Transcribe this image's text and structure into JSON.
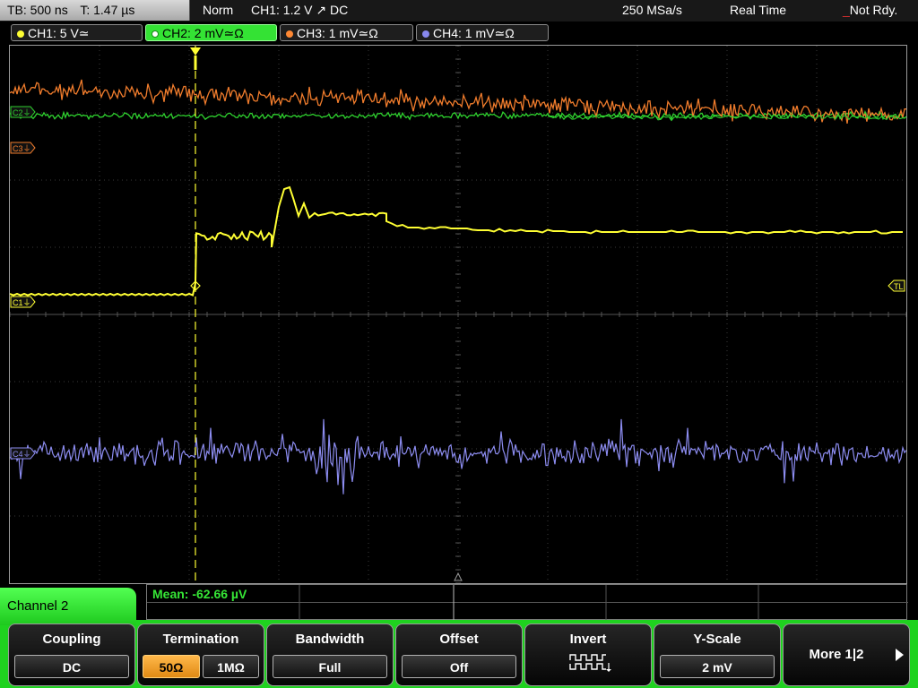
{
  "status": {
    "timebase": "TB: 500 ns",
    "trigger_time": "T: 1.47 µs",
    "mode": "Norm",
    "trigger_info": "CH1: 1.2 V ↗ DC",
    "sample_rate": "250 MSa/s",
    "acquisition": "Real Time",
    "state": "Not Rdy."
  },
  "channels": [
    {
      "label": "CH1: 5 V≃",
      "color": "#ffff33",
      "active": false
    },
    {
      "label": "CH2: 2 mV≃Ω",
      "color": "#33dd33",
      "active": true
    },
    {
      "label": "CH3: 1 mV≃Ω",
      "color": "#ff8833",
      "active": false
    },
    {
      "label": "CH4: 1 mV≃Ω",
      "color": "#8888ee",
      "active": false
    }
  ],
  "screen": {
    "markers": {
      "c1": "C1⏚",
      "c2": "C2⏚",
      "c3": "C3⏚",
      "c4": "C4⏚",
      "trigger_level": "TL"
    },
    "grid_color": "#3a3a3a",
    "trigger_color": "#ffff33"
  },
  "measurement": {
    "mean": "Mean: -62.66 µV"
  },
  "menu": {
    "channel_title": "Channel 2",
    "coupling": {
      "title": "Coupling",
      "value": "DC"
    },
    "termination": {
      "title": "Termination",
      "options": [
        "50Ω",
        "1MΩ"
      ],
      "selected": "50Ω"
    },
    "bandwidth": {
      "title": "Bandwidth",
      "value": "Full"
    },
    "offset": {
      "title": "Offset",
      "value": "Off"
    },
    "invert": {
      "title": "Invert",
      "icon": "invert-waveform-icon"
    },
    "y_scale": {
      "title": "Y-Scale",
      "value": "2 mV"
    },
    "more": {
      "title": "More 1|2",
      "icon": "chevron-right-icon"
    }
  }
}
